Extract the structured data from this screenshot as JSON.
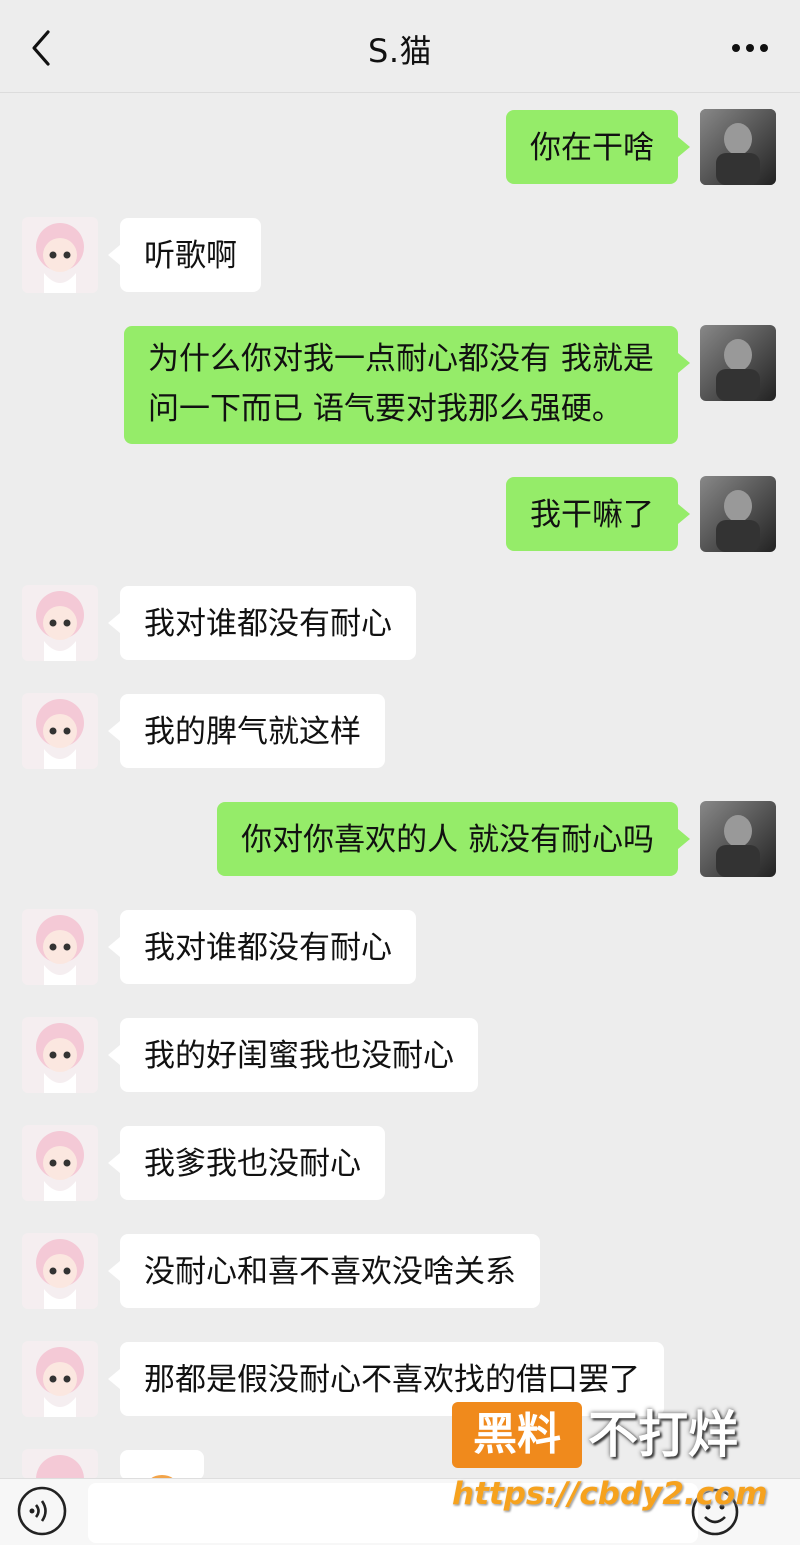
{
  "header": {
    "title": "S.猫",
    "back_icon": "chevron-left-icon",
    "more_icon": "more-dots-icon"
  },
  "messages": [
    {
      "from": "me",
      "text": "你在干啥"
    },
    {
      "from": "other",
      "text": "听歌啊"
    },
    {
      "from": "me",
      "text": "为什么你对我一点耐心都没有 我就是问一下而已 语气要对我那么强硬。"
    },
    {
      "from": "me",
      "text": "我干嘛了"
    },
    {
      "from": "other",
      "text": "我对谁都没有耐心"
    },
    {
      "from": "other",
      "text": "我的脾气就这样"
    },
    {
      "from": "me",
      "text": "你对你喜欢的人 就没有耐心吗"
    },
    {
      "from": "other",
      "text": "我对谁都没有耐心"
    },
    {
      "from": "other",
      "text": "我的好闺蜜我也没耐心"
    },
    {
      "from": "other",
      "text": "我爹我也没耐心"
    },
    {
      "from": "other",
      "text": "没耐心和喜不喜欢没啥关系"
    },
    {
      "from": "other",
      "text": "那都是假没耐心不喜欢找的借口罢了"
    },
    {
      "from": "other",
      "text": ""
    }
  ],
  "input_bar": {
    "voice_icon": "voice-icon",
    "emoji_icon": "emoji-icon"
  },
  "watermark": {
    "box": "黑料",
    "text": "不打烊",
    "url": "https://cbdy2.com"
  },
  "colors": {
    "me_bubble": "#95ec69",
    "other_bubble": "#ffffff",
    "background": "#ededed"
  }
}
